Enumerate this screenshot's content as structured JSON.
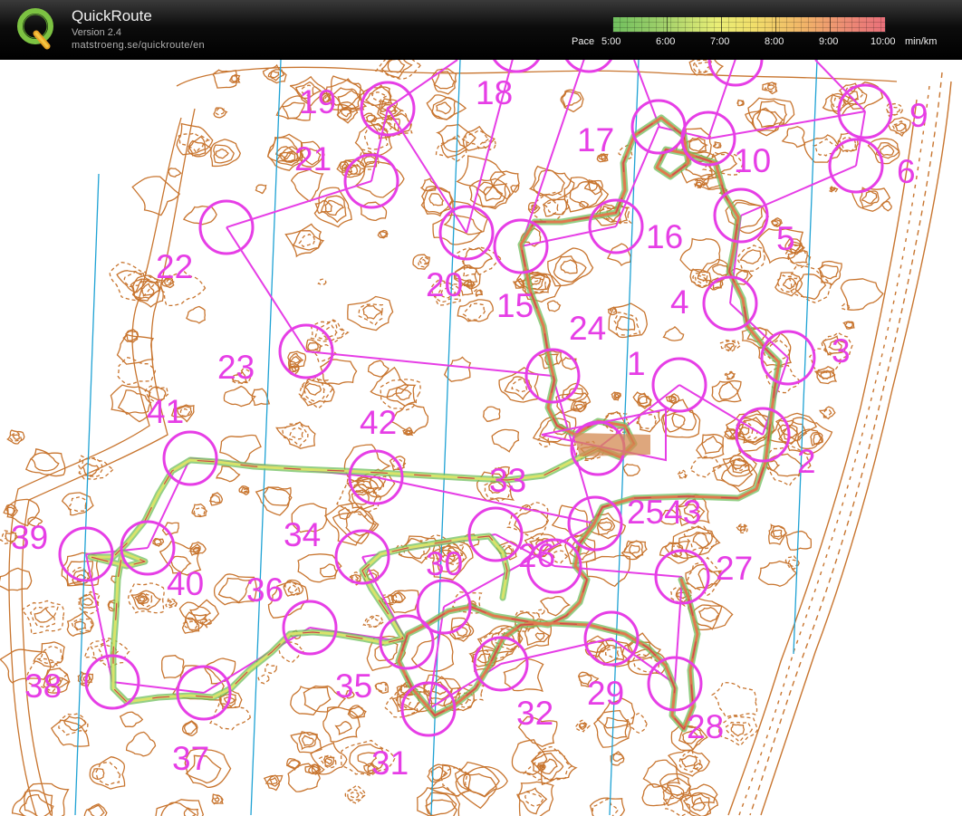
{
  "app": {
    "title": "QuickRoute",
    "version": "Version 2.4",
    "url": "matstroeng.se/quickroute/en",
    "logo_letter": "Q"
  },
  "pace_legend": {
    "caption": "Pace",
    "labels": [
      "5:00",
      "6:00",
      "7:00",
      "8:00",
      "9:00",
      "10:00"
    ],
    "unit": "min/km",
    "colors": [
      "#6fbf5e",
      "#e9ee76",
      "#f1b468",
      "#e96f7a"
    ]
  },
  "map": {
    "course_color": "#e63ee6",
    "contour_color": "#c8752f",
    "north_line_color": "#1fa2d4",
    "route_colors": [
      "#6fbf5e",
      "#d9e36a",
      "#e07a4e",
      "#c94a4a"
    ],
    "control_labels": [
      "1",
      "2",
      "3",
      "4",
      "5",
      "6",
      "9",
      "10",
      "15",
      "16",
      "17",
      "18",
      "19",
      "20",
      "21",
      "22",
      "23",
      "24",
      "2543",
      "26",
      "27",
      "28",
      "29",
      "30",
      "31",
      "32",
      "33",
      "34",
      "35",
      "36",
      "37",
      "38",
      "39",
      "40",
      "41",
      "42"
    ]
  }
}
